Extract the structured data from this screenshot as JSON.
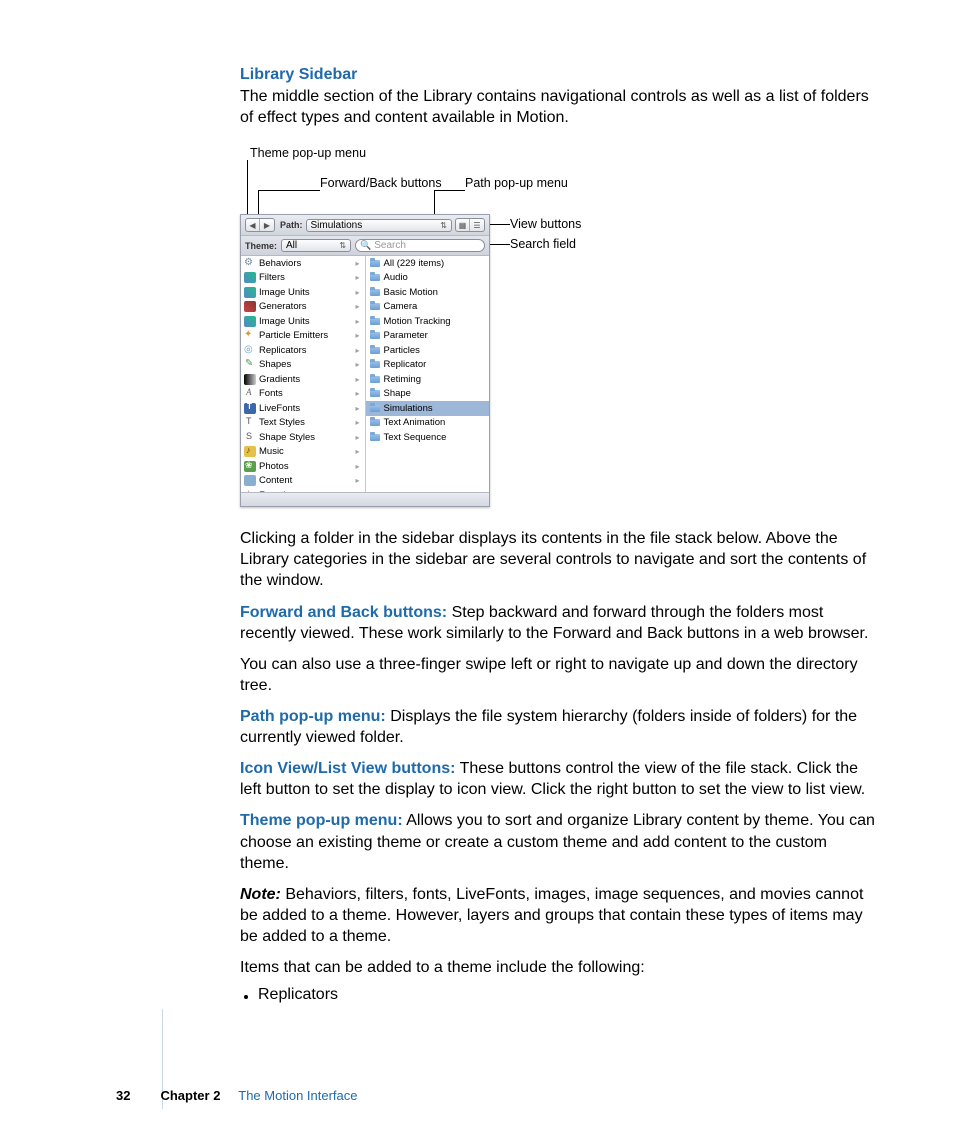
{
  "heading": "Library Sidebar",
  "intro": "The middle section of the Library contains navigational controls as well as a list of folders of effect types and content available in Motion.",
  "callouts": {
    "theme": "Theme pop-up menu",
    "fwdback": "Forward/Back buttons",
    "path": "Path pop-up menu",
    "view": "View buttons",
    "search": "Search field"
  },
  "ui": {
    "path_label": "Path:",
    "path_value": "Simulations",
    "theme_label": "Theme:",
    "theme_value": "All",
    "search_placeholder": "Search",
    "left_column": [
      "Behaviors",
      "Filters",
      "Image Units",
      "Generators",
      "Image Units",
      "Particle Emitters",
      "Replicators",
      "Shapes",
      "Gradients",
      "Fonts",
      "LiveFonts",
      "Text Styles",
      "Shape Styles",
      "Music",
      "Photos",
      "Content",
      "Favorites"
    ],
    "right_column": [
      "All (229 items)",
      "Audio",
      "Basic Motion",
      "Camera",
      "Motion Tracking",
      "Parameter",
      "Particles",
      "Replicator",
      "Retiming",
      "Shape",
      "Simulations",
      "Text Animation",
      "Text Sequence"
    ],
    "right_selected_index": 10
  },
  "body": {
    "p1": "Clicking a folder in the sidebar displays its contents in the file stack below. Above the Library categories in the sidebar are several controls to navigate and sort the contents of the window.",
    "t1_label": "Forward and Back buttons:",
    "t1_text": "  Step backward and forward through the folders most recently viewed. These work similarly to the Forward and Back buttons in a web browser.",
    "p2": "You can also use a three-finger swipe left or right to navigate up and down the directory tree.",
    "t2_label": "Path pop-up menu:",
    "t2_text": "  Displays the file system hierarchy (folders inside of folders) for the currently viewed folder.",
    "t3_label": "Icon View/List View buttons:",
    "t3_text": "  These buttons control the view of the file stack. Click the left button to set the display to icon view. Click the right button to set the view to list view.",
    "t4_label": "Theme pop-up menu:",
    "t4_text": "  Allows you to sort and organize Library content by theme. You can choose an existing theme or create a custom theme and add content to the custom theme.",
    "note_label": "Note:",
    "note_text": "  Behaviors, filters, fonts, LiveFonts, images, image sequences, and movies cannot be added to a theme. However, layers and groups that contain these types of items may be added to a theme.",
    "p3": "Items that can be added to a theme include the following:",
    "bullet1": "Replicators"
  },
  "footer": {
    "page": "32",
    "chapter_label": "Chapter 2",
    "chapter_title": "The Motion Interface"
  }
}
